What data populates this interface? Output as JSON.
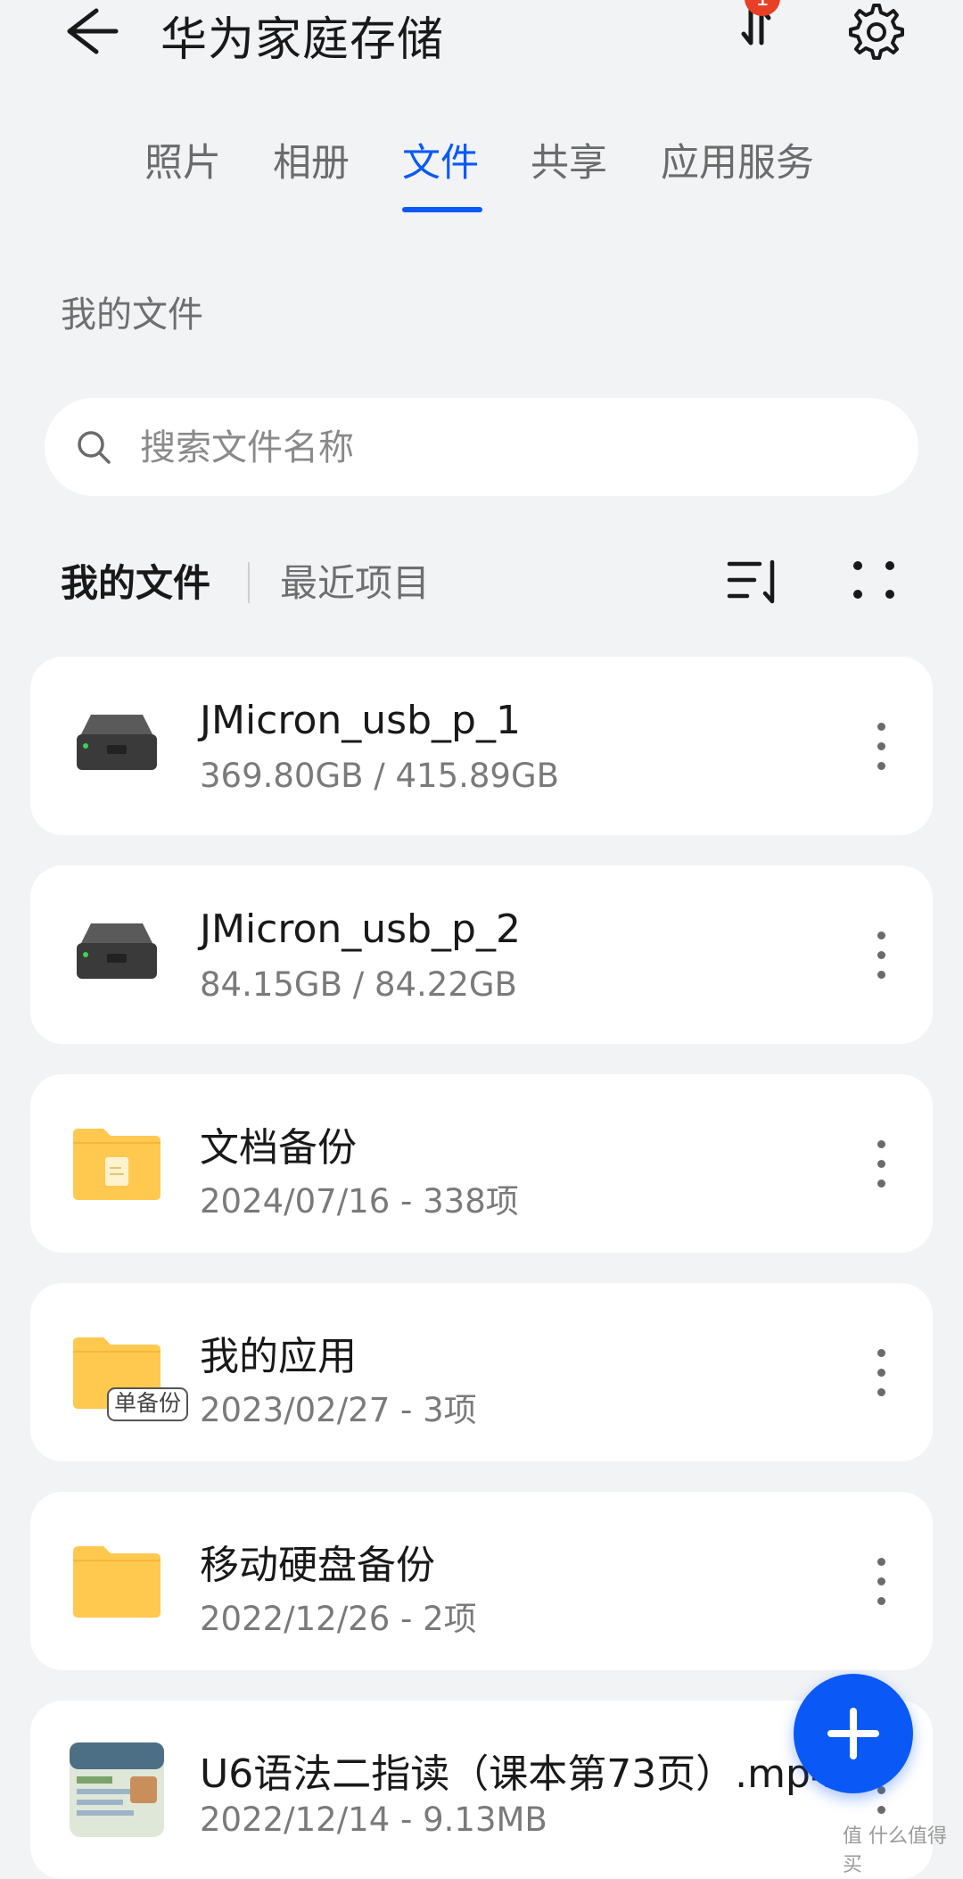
{
  "header": {
    "title": "华为家庭存储",
    "transfer_badge": "1",
    "back_icon": "arrow-left-icon",
    "transfer_icon": "transfer-arrows-icon",
    "settings_icon": "gear-icon"
  },
  "tabs": [
    {
      "label": "照片",
      "active": false
    },
    {
      "label": "相册",
      "active": false
    },
    {
      "label": "文件",
      "active": true
    },
    {
      "label": "共享",
      "active": false
    },
    {
      "label": "应用服务",
      "active": false
    }
  ],
  "section_label": "我的文件",
  "search": {
    "placeholder": "搜索文件名称"
  },
  "subtabs": {
    "mine": "我的文件",
    "recent": "最近项目"
  },
  "files": [
    {
      "name": "JMicron_usb_p_1",
      "meta": "369.80GB / 415.89GB",
      "icon": "hard-drive-icon"
    },
    {
      "name": "JMicron_usb_p_2",
      "meta": "84.15GB / 84.22GB",
      "icon": "hard-drive-icon"
    },
    {
      "name": "文档备份",
      "meta": "2024/07/16 - 338项",
      "icon": "document-folder-icon"
    },
    {
      "name": "我的应用",
      "meta": "2023/02/27 - 3项",
      "icon": "folder-icon",
      "badge": "单备份"
    },
    {
      "name": "移动硬盘备份",
      "meta": "2022/12/26 - 2项",
      "icon": "folder-icon"
    },
    {
      "name": "U6语法二指读（课本第73页）.mp4",
      "meta": "2022/12/14 - 9.13MB",
      "icon": "video-thumbnail-icon"
    }
  ],
  "watermark": "值 什么值得买",
  "colors": {
    "accent": "#0a59f7",
    "background": "#f1f3f5",
    "folder": "#ffc84f",
    "badge": "#e84026"
  }
}
